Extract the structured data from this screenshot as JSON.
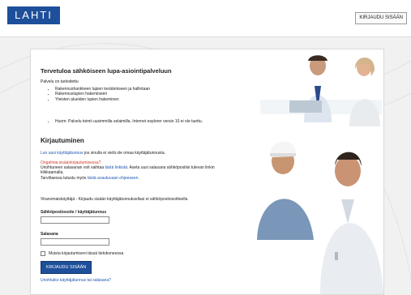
{
  "header": {
    "logo_text": "LAHTI",
    "login_button": "KIRJAUDU SISÄÄN"
  },
  "intro": {
    "title": "Tervetuloa sähköiseen lupa-asiointipalveluun",
    "purpose_label": "Palvelu on tarkoitettu",
    "bullets": [
      "Rakennushankkeen lupien keräämiseen ja hallintaan",
      "Rakennuslupien hakemiseen",
      "Yleisten alueiden lupien hakeminen"
    ],
    "note": "Huom: Palvelu toimii uusimmilla selaimilla. Internet explorer versio 10 ei ole tuettu."
  },
  "login": {
    "title": "Kirjautuminen",
    "register_link": "Luo uusi käyttäjätunnus",
    "register_text": "jos sinulla ei vielä ole omaa käyttäjätunnusta.",
    "problem_heading": "Ongelmia sisäänkirjautumisessa?",
    "forgot_text_1": "Unohtuneen salasanan voit vaihtaa",
    "forgot_link": "tästä linkistä",
    "forgot_text_2": ". Aseta uusi salasana sähköpostiisi tulevan linkin",
    "forgot_text_3": "klikkaamalla.",
    "guide_text": "Tarvittaessa tutustu myös",
    "guide_link": "tästä avautuvaan ohjeeseen.",
    "official_text": "Viranomaiskäyttäjä - Kirjaudu sisään käyttäjätunnuksellasi ei sähköpostiosoitteella",
    "username_label": "Sähköpostiosoite / käyttäjätunnus",
    "username_value": "",
    "password_label": "Salasana",
    "password_value": "",
    "remember_label": "Muista kirjautumiseni tässä tietokoneessa",
    "submit_label": "KIRJAUDU SISÄÄN",
    "forgot_bottom_link": "Unohtuiko käyttäjätunnus tai salasana?"
  },
  "colors": {
    "brand_blue": "#1d4f9a",
    "link_blue": "#1f57b4",
    "error_red": "#d23b2b"
  }
}
